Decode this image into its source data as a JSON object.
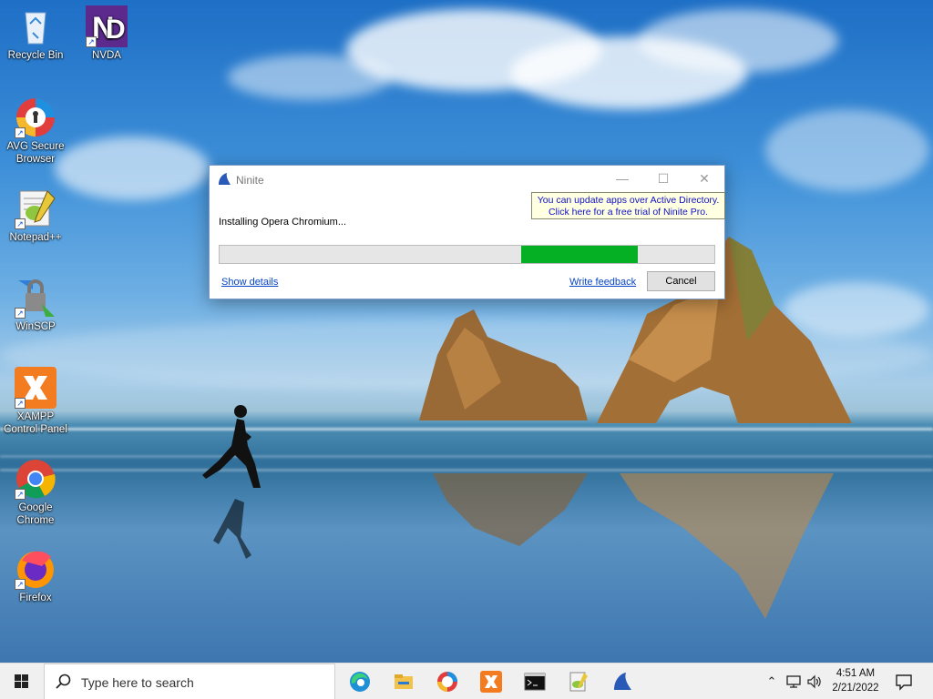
{
  "desktop": {
    "icons": [
      {
        "label": "Recycle Bin"
      },
      {
        "label": "NVDA"
      },
      {
        "label": "AVG Secure Browser"
      },
      {
        "label": "Notepad++"
      },
      {
        "label": "WinSCP"
      },
      {
        "label": "XAMPP Control Panel"
      },
      {
        "label": "Google Chrome"
      },
      {
        "label": "Firefox"
      }
    ]
  },
  "window": {
    "title": "Ninite",
    "tooltip_line1": "You can update apps over Active Directory.",
    "tooltip_line2": "Click here for a free trial of Ninite Pro.",
    "status": "Installing Opera Chromium...",
    "progress_start": 0.61,
    "progress_end": 0.845,
    "show_details": "Show details",
    "write_feedback": "Write feedback",
    "cancel": "Cancel",
    "progress_color": "#06b025"
  },
  "taskbar": {
    "search_placeholder": "Type here to search",
    "apps": [
      "edge-icon",
      "file-explorer-icon",
      "avg-browser-icon",
      "xampp-icon",
      "cmd-icon",
      "notepadpp-icon",
      "ninite-icon"
    ],
    "time": "4:51 AM",
    "date": "2/21/2022"
  }
}
